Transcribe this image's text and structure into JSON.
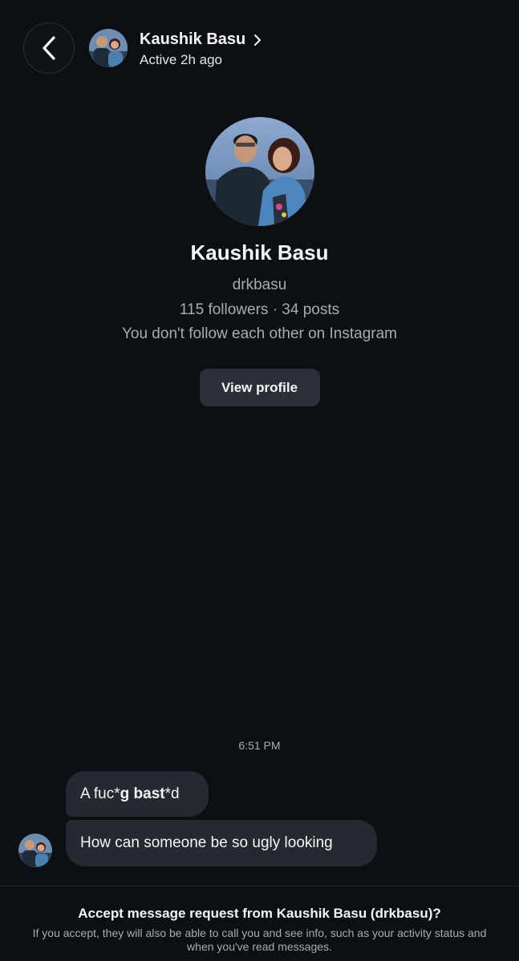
{
  "header": {
    "name": "Kaushik Basu",
    "status": "Active 2h ago",
    "back_icon": "chevron-left-icon",
    "name_chevron_icon": "chevron-right-icon"
  },
  "profile": {
    "name": "Kaushik Basu",
    "handle": "drkbasu",
    "stats": "115 followers · 34 posts",
    "note": "You don't follow each other on Instagram",
    "view_button": "View profile"
  },
  "conversation": {
    "timestamp": "6:51 PM",
    "messages": [
      {
        "parts": [
          "A fuc*",
          "g bast",
          "*d"
        ]
      },
      {
        "text": "How can someone be so ugly looking"
      }
    ]
  },
  "footer": {
    "title": "Accept message request from Kaushik Basu (drkbasu)?",
    "description": "If you accept, they will also be able to call you and see info, such as your activity status and when you've read messages."
  },
  "colors": {
    "background": "#0c0f14",
    "bubble": "#26292f",
    "button": "#2b2f38",
    "secondary_text": "#a8acb3"
  }
}
